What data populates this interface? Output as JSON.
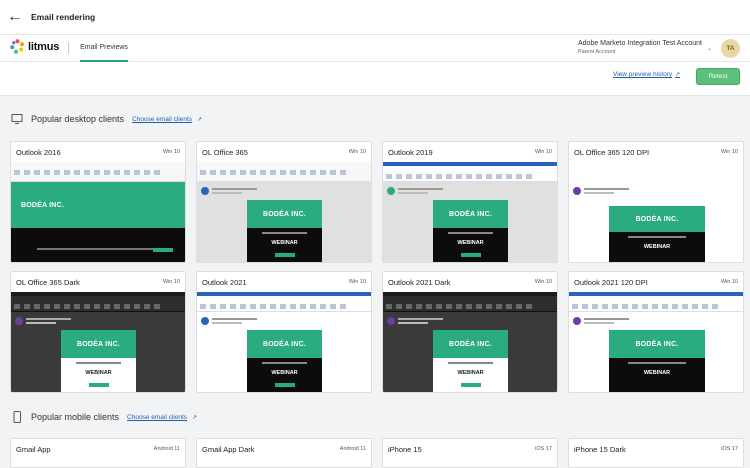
{
  "topbar": {
    "title": "Email rendering"
  },
  "header": {
    "logo_text": "litmus",
    "nav_tab": "Email Previews",
    "account_name": "Adobe Marketo Integration Test Account",
    "account_sub": "Parent Account",
    "avatar_initials": "TA"
  },
  "actions": {
    "history_link": "View preview history",
    "retest_label": "Retest"
  },
  "sections": {
    "desktop": {
      "title": "Popular desktop clients",
      "link": "Choose email clients"
    },
    "mobile": {
      "title": "Popular mobile clients",
      "link": "Choose email clients"
    }
  },
  "desktop_cards": [
    {
      "name": "Outlook 2016",
      "os": "Win 10"
    },
    {
      "name": "OL Office 365",
      "os": "Win 10"
    },
    {
      "name": "Outlook 2019",
      "os": "Win 10"
    },
    {
      "name": "OL Office 365 120 DPI",
      "os": "Win 10"
    },
    {
      "name": "OL Office 365 Dark",
      "os": "Win 10"
    },
    {
      "name": "Outlook 2021",
      "os": "Win 10"
    },
    {
      "name": "Outlook 2021 Dark",
      "os": "Win 10"
    },
    {
      "name": "Outlook 2021 120 DPI",
      "os": "Win 10"
    }
  ],
  "mobile_cards": [
    {
      "name": "Gmail App",
      "os": "Android 11"
    },
    {
      "name": "Gmail App Dark",
      "os": "Android 11"
    },
    {
      "name": "iPhone 15",
      "os": "iOS 17"
    },
    {
      "name": "iPhone 15 Dark",
      "os": "iOS 17"
    }
  ],
  "email_preview": {
    "brand": "BODÉA INC.",
    "banner": "WEBINAR"
  },
  "colors": {
    "accent": "#29a36a",
    "retest": "#5cbf7b",
    "brand_green": "#2bab82",
    "link": "#1f5fb0"
  }
}
